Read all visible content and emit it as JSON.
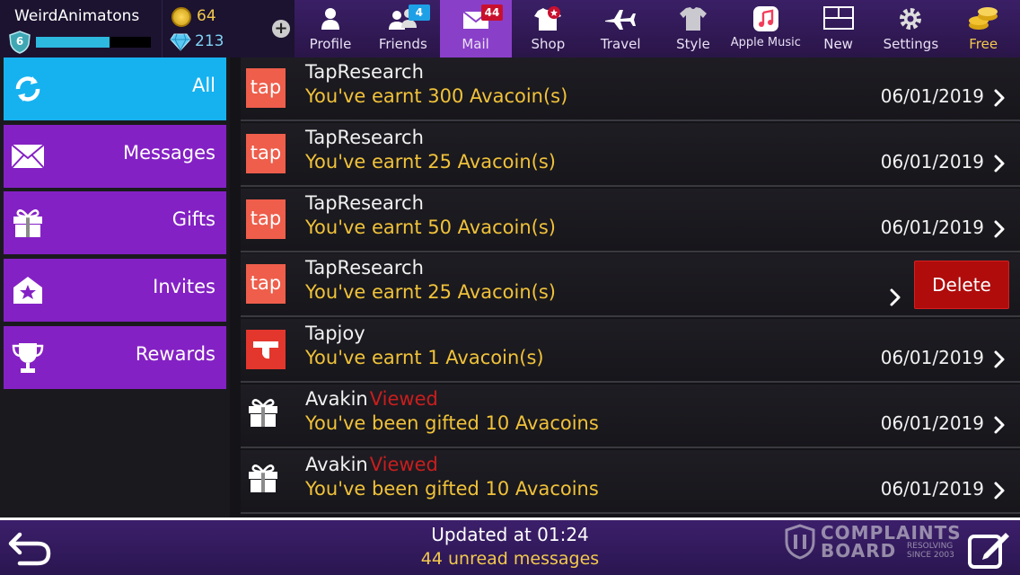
{
  "user": {
    "name": "WeirdAnimatons",
    "level": "6",
    "xp_fraction": 0.64
  },
  "currency": {
    "coins": "64",
    "gems": "213"
  },
  "nav": [
    {
      "label": "Profile",
      "icon": "profile-icon"
    },
    {
      "label": "Friends",
      "icon": "friends-icon",
      "badge": "4"
    },
    {
      "label": "Mail",
      "icon": "mail-icon",
      "badge": "44",
      "active": true
    },
    {
      "label": "Shop",
      "icon": "shop-icon"
    },
    {
      "label": "Travel",
      "icon": "airplane-icon"
    },
    {
      "label": "Style",
      "icon": "shirt-icon"
    },
    {
      "label": "Apple Music",
      "icon": "music-icon"
    },
    {
      "label": "New",
      "icon": "new-icon"
    },
    {
      "label": "Settings",
      "icon": "gear-icon"
    },
    {
      "label": "Free",
      "icon": "coin-stack-icon"
    }
  ],
  "sidebar": [
    {
      "label": "All",
      "icon": "refresh-icon",
      "active": true
    },
    {
      "label": "Messages",
      "icon": "envelope-icon"
    },
    {
      "label": "Gifts",
      "icon": "gift-icon"
    },
    {
      "label": "Invites",
      "icon": "invite-icon"
    },
    {
      "label": "Rewards",
      "icon": "trophy-icon"
    }
  ],
  "messages": [
    {
      "sender": "TapResearch",
      "body": "You've earnt 300 Avacoin(s)",
      "date": "06/01/2019",
      "icon": "tapresearch-logo",
      "logo_text": "tap"
    },
    {
      "sender": "TapResearch",
      "body": "You've earnt 25 Avacoin(s)",
      "date": "06/01/2019",
      "icon": "tapresearch-logo",
      "logo_text": "tap"
    },
    {
      "sender": "TapResearch",
      "body": "You've earnt 50 Avacoin(s)",
      "date": "06/01/2019",
      "icon": "tapresearch-logo",
      "logo_text": "tap"
    },
    {
      "sender": "TapResearch",
      "body": "You've earnt 25 Avacoin(s)",
      "date": "",
      "icon": "tapresearch-logo",
      "logo_text": "tap",
      "delete_label": "Delete"
    },
    {
      "sender": "Tapjoy",
      "body": "You've earnt 1 Avacoin(s)",
      "date": "06/01/2019",
      "icon": "tapjoy-logo"
    },
    {
      "sender": "Avakin",
      "status": "Viewed",
      "body": "You've been gifted 10 Avacoins",
      "date": "06/01/2019",
      "icon": "gift-icon"
    },
    {
      "sender": "Avakin",
      "status": "Viewed",
      "body": "You've been gifted 10 Avacoins",
      "date": "06/01/2019",
      "icon": "gift-icon"
    }
  ],
  "footer": {
    "updated": "Updated at 01:24",
    "unread": "44 unread messages",
    "watermark_line1": "COMPLAINTS",
    "watermark_line2": "BOARD",
    "watermark_line3": "RESOLVING SINCE 2003"
  },
  "colors": {
    "accent_purple": "#8421c4",
    "active_blue": "#16b2f0",
    "gold_text": "#f0c23a",
    "delete_red": "#b00c0c"
  }
}
